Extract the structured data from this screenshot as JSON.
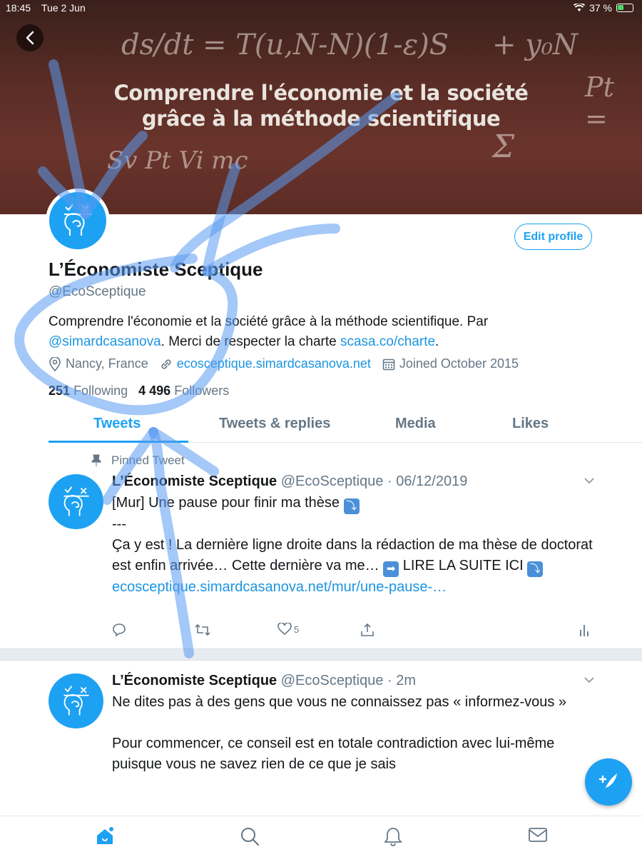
{
  "status_bar": {
    "time": "18:45",
    "date": "Tue 2 Jun",
    "battery": "37 %"
  },
  "banner": {
    "line1": "Comprendre l'économie et la société",
    "line2": "grâce à la méthode scientifique"
  },
  "profile": {
    "edit_label": "Edit profile",
    "name": "L’Économiste Sceptique",
    "handle": "@EcoSceptique",
    "bio_part1": "Comprendre l'économie et la société grâce à la méthode scientifique. Par",
    "bio_mention": "@simardcasanova",
    "bio_part2": ". Merci de respecter la charte",
    "bio_link": "scasa.co/charte",
    "bio_end": ".",
    "location": "Nancy, France",
    "website": "ecosceptique.simardcasanova.net",
    "joined": "Joined October 2015",
    "following_count": "251",
    "following_label": "Following",
    "followers_count": "4 496",
    "followers_label": "Followers"
  },
  "tabs": [
    "Tweets",
    "Tweets & replies",
    "Media",
    "Likes"
  ],
  "tweets": [
    {
      "pinned_label": "Pinned Tweet",
      "name": "L’Économiste Sceptique",
      "meta": "@EcoSceptique · 06/12/2019",
      "line1": "[Mur] Une pause pour finir ma thèse",
      "line2": "---",
      "line3": "Ça y est ! La dernière ligne droite dans la rédaction de ma thèse de doctorat est enfin arrivée… Cette dernière va me… ",
      "line3b": " LIRE LA SUITE ICI",
      "link": "ecosceptique.simardcasanova.net/mur/une-pause-…",
      "likes": "5",
      "emoji_down": "⤵",
      "emoji_right": "➡"
    },
    {
      "name": "L’Économiste Sceptique",
      "meta": "@EcoSceptique · 2m",
      "para1": "Ne dites pas à des gens que vous ne connaissez pas « informez-vous »",
      "para2": "Pour commencer, ce conseil est en totale contradiction avec lui-même puisque vous ne savez rien de ce que je sais"
    }
  ],
  "icons": {
    "back": "chevron-left-icon",
    "location": "map-pin-icon",
    "website": "link-icon",
    "joined": "calendar-icon",
    "pin": "pin-icon",
    "reply": "reply-icon",
    "retweet": "retweet-icon",
    "like": "heart-icon",
    "share": "share-icon",
    "analytics": "analytics-icon",
    "compose": "compose-icon",
    "home": "home-icon",
    "search": "search-icon",
    "notifications": "bell-icon",
    "messages": "mail-icon"
  },
  "colors": {
    "accent": "#1da1f2",
    "link": "#1b95e0",
    "muted": "#657786",
    "annotation": "#5a9bf0"
  }
}
